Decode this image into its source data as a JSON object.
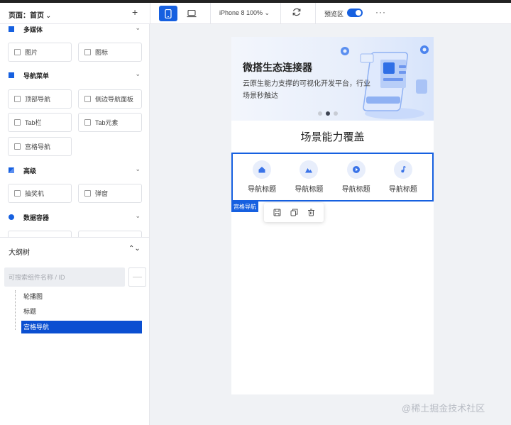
{
  "header": {
    "page_label": "页面：首页",
    "page_chevron": "⌄",
    "add_label": "+",
    "device_select": "iPhone 8 100% ⌄",
    "preview_label": "预览区",
    "more_label": "···"
  },
  "components": {
    "sections": [
      {
        "label": "多媒体",
        "color": "#1660e0",
        "items": [
          "图片",
          "图标"
        ]
      },
      {
        "label": "导航菜单",
        "color": "#1660e0",
        "items": [
          "顶部导航",
          "侧边导航面板",
          "Tab栏",
          "Tab元素",
          "宫格导航"
        ]
      },
      {
        "label": "高级",
        "color": "#1660e0",
        "items": [
          "抽奖机",
          "弹窗"
        ]
      },
      {
        "label": "数据容器",
        "color": "#1660e0",
        "items": []
      }
    ],
    "chevron": "⌄"
  },
  "outline": {
    "title": "大纲树",
    "toggle": "⌃⌄",
    "search_placeholder": "可搜索组件名称 / ID",
    "items": [
      "轮播图",
      "标题",
      "宫格导航"
    ],
    "selected_index": 2
  },
  "canvas": {
    "banner": {
      "title": "微搭生态连接器",
      "subtitle": "云原生能力支撑的可视化开发平台，行业场景秒触达",
      "dot_count": 3,
      "active_dot": 1
    },
    "section_title": "场景能力覆盖",
    "grid_nav": {
      "items": [
        {
          "label": "导航标题",
          "icon": "home-icon"
        },
        {
          "label": "导航标题",
          "icon": "mountain-icon"
        },
        {
          "label": "导航标题",
          "icon": "play-icon"
        },
        {
          "label": "导航标题",
          "icon": "music-icon"
        }
      ],
      "tag": "宫格导航"
    },
    "toolbar_icons": [
      "save-icon",
      "copy-icon",
      "delete-icon"
    ]
  },
  "watermark": "@稀土掘金技术社区",
  "colors": {
    "accent": "#1660e0",
    "selected": "#0b4fd1"
  }
}
